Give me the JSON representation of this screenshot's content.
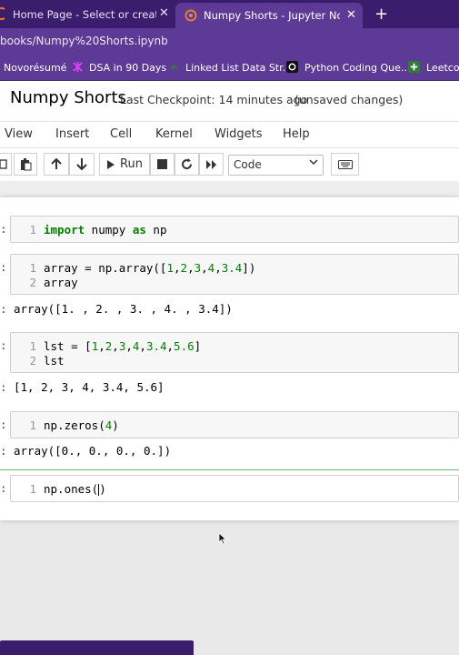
{
  "browser": {
    "tabs": [
      {
        "title": "Home Page - Select or create a n",
        "active": false
      },
      {
        "title": "Numpy Shorts - Jupyter Noteboo",
        "active": true
      }
    ],
    "new_tab": "+",
    "close": "✕",
    "url": "books/Numpy%20Shorts.ipynb",
    "bookmarks": [
      {
        "label": "Novorésumé"
      },
      {
        "label": "DSA in 90 Days"
      },
      {
        "label": "Linked List Data Str..."
      },
      {
        "label": "Python Coding Que..."
      },
      {
        "label": "Leetcod"
      }
    ]
  },
  "notebook": {
    "name": "Numpy Shorts",
    "checkpoint": "Last Checkpoint: 14 minutes ago",
    "status": "(unsaved changes)"
  },
  "menu": [
    "View",
    "Insert",
    "Cell",
    "Kernel",
    "Widgets",
    "Help"
  ],
  "toolbar": {
    "run_label": "Run",
    "cell_type": "Code"
  },
  "cells": [
    {
      "lines": [
        "1"
      ],
      "code": [
        "import numpy as np"
      ]
    },
    {
      "lines": [
        "1",
        "2"
      ],
      "code": [
        "array = np.array([1,2,3,4,3.4])",
        "array"
      ],
      "output": "array([1. , 2. , 3. , 4. , 3.4])"
    },
    {
      "lines": [
        "1",
        "2"
      ],
      "code": [
        "lst = [1,2,3,4,3.4,5.6]",
        "lst"
      ],
      "output": "[1, 2, 3, 4, 3.4, 5.6]"
    },
    {
      "lines": [
        "1"
      ],
      "code": [
        "np.zeros(4)"
      ],
      "output": "array([0., 0., 0., 0.])"
    },
    {
      "lines": [
        "1"
      ],
      "code": [
        "np.ones()"
      ]
    }
  ],
  "prompt_mark": ":",
  "colors": {
    "tabbar": "#3b1d6e",
    "chrome": "#5d3a96",
    "keyword": "#008000",
    "active_cell": "#66bb6a"
  }
}
